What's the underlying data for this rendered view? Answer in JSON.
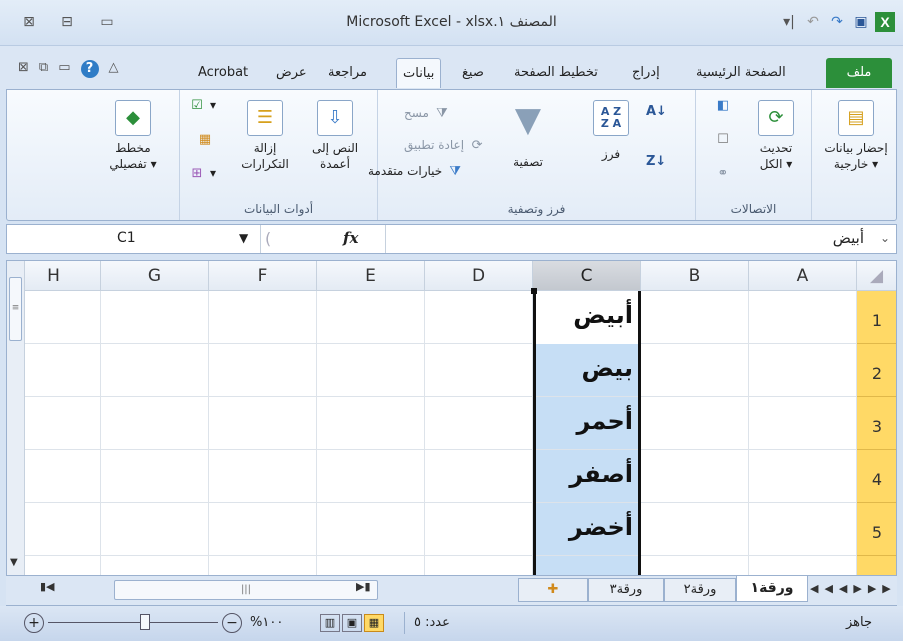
{
  "title": "Microsoft Excel - xlsx.المصنف ١",
  "window_controls": {
    "close": "⊠",
    "restore": "⊟",
    "minimize": "▭"
  },
  "tabs": [
    {
      "label": "ملف",
      "selected": false
    },
    {
      "label": "الصفحة الرئيسية",
      "selected": false
    },
    {
      "label": "إدراج",
      "selected": false
    },
    {
      "label": "تخطيط الصفحة",
      "selected": false
    },
    {
      "label": "صيغ",
      "selected": false
    },
    {
      "label": "بيانات",
      "selected": true
    },
    {
      "label": "مراجعة",
      "selected": false
    },
    {
      "label": "عرض",
      "selected": false
    },
    {
      "label": "Acrobat",
      "selected": false
    }
  ],
  "ribbon": {
    "external_data": {
      "label": "إحضار بيانات",
      "sub": "خارجية ▾"
    },
    "connections": {
      "refresh_label": "تحديث",
      "refresh_sub": "الكل ▾",
      "group": "الاتصالات"
    },
    "sort_filter": {
      "sort": "فرز",
      "filter": "تصفية",
      "clear": "مسح",
      "reapply": "إعادة تطبيق",
      "advanced": "خيارات متقدمة",
      "group": "فرز وتصفية",
      "az": "A Z",
      "za": "Z A"
    },
    "data_tools": {
      "text_to_columns": "النص إلى",
      "text_to_columns2": "أعمدة",
      "remove_dup": "إزالة",
      "remove_dup2": "التكرارات",
      "group": "أدوات البيانات"
    },
    "outline": {
      "label": "مخطط",
      "sub": "تفصيلي ▾"
    }
  },
  "formula_bar": {
    "name_box": "C1",
    "fx": "fx",
    "value": "أبيض"
  },
  "columns": [
    "A",
    "B",
    "C",
    "D",
    "E",
    "F",
    "G",
    "H"
  ],
  "rows": [
    "1",
    "2",
    "3",
    "4",
    "5"
  ],
  "cells_c": [
    "أبيض",
    "بيض",
    "أحمر",
    "أصفر",
    "أخضر"
  ],
  "sheets": [
    "ورقة١",
    "ورقة٢",
    "ورقة٣"
  ],
  "status": {
    "ready": "جاهز",
    "count": "عدد: ٥",
    "zoom": "%١٠٠"
  },
  "colors": {
    "accent": "#2c8f3a",
    "selection": "#c6def5",
    "row_header": "#ffd966"
  }
}
